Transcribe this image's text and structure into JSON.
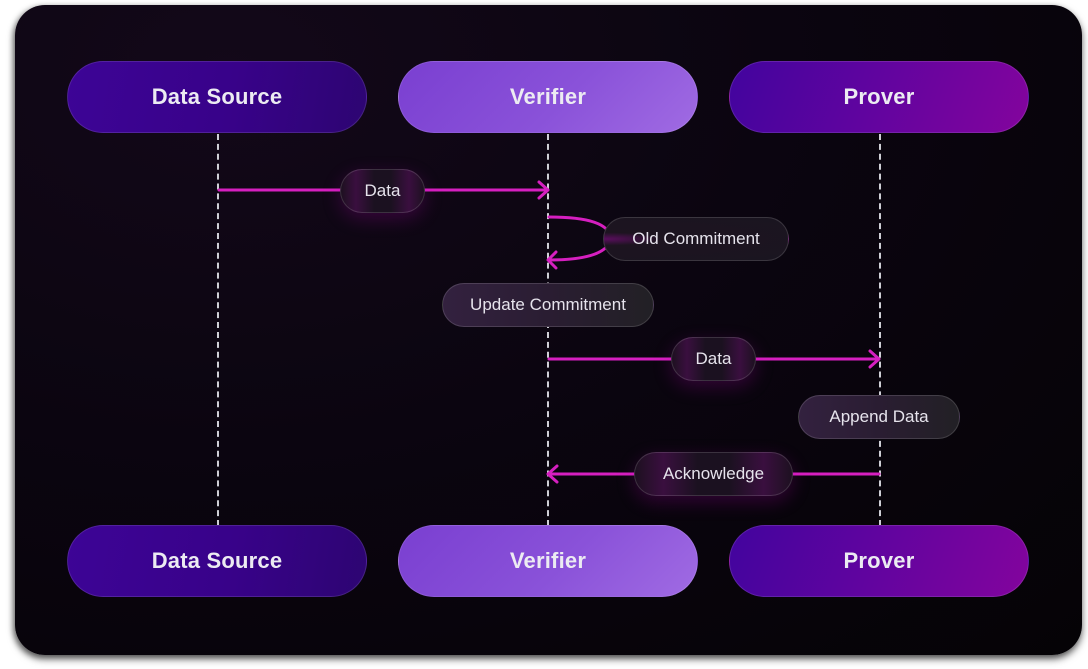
{
  "diagram": {
    "type": "sequence",
    "accent_color": "#d61fc0",
    "participants_top": [
      {
        "id": "data-source",
        "label": "Data Source"
      },
      {
        "id": "verifier",
        "label": "Verifier"
      },
      {
        "id": "prover",
        "label": "Prover"
      }
    ],
    "participants_bottom": [
      {
        "id": "data-source",
        "label": "Data Source"
      },
      {
        "id": "verifier",
        "label": "Verifier"
      },
      {
        "id": "prover",
        "label": "Prover"
      }
    ],
    "messages": [
      {
        "from": "data-source",
        "to": "verifier",
        "label": "Data"
      },
      {
        "from": "verifier",
        "to": "verifier",
        "label": "Old Commitment"
      },
      {
        "note_on": "verifier",
        "label": "Update Commitment"
      },
      {
        "from": "verifier",
        "to": "prover",
        "label": "Data"
      },
      {
        "note_on": "prover",
        "label": "Append Data"
      },
      {
        "from": "prover",
        "to": "verifier",
        "label": "Acknowledge"
      }
    ]
  }
}
